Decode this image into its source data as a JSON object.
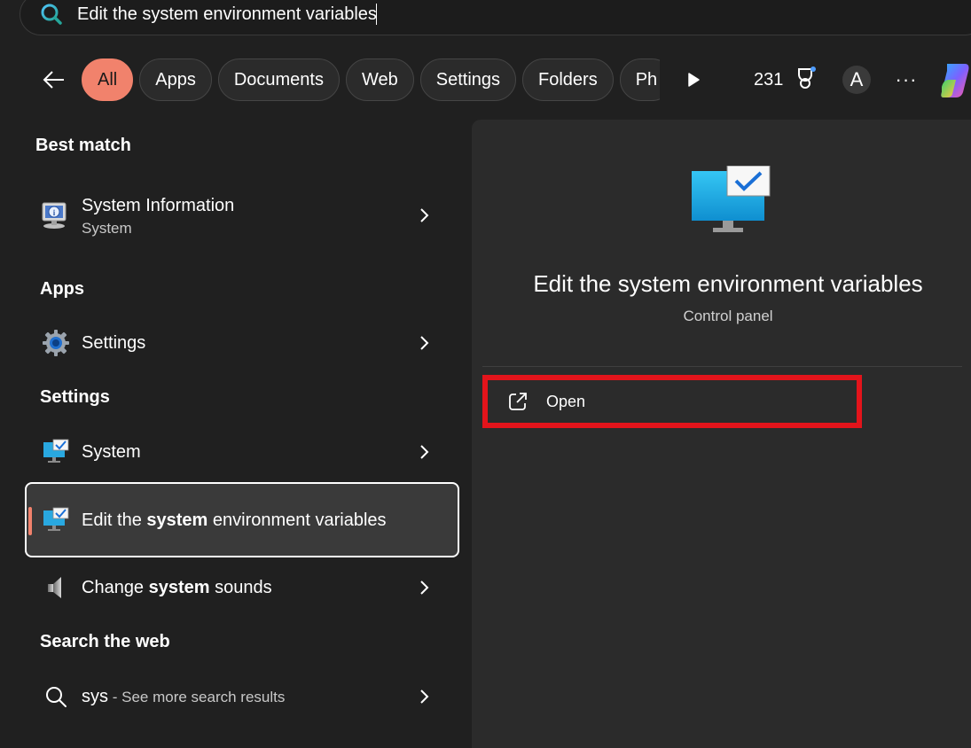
{
  "search": {
    "query": "Edit the system environment variables"
  },
  "filters": {
    "chips": [
      "All",
      "Apps",
      "Documents",
      "Web",
      "Settings",
      "Folders",
      "Ph"
    ],
    "active": "All",
    "points": "231",
    "avatar_letter": "A",
    "more": "···"
  },
  "results": {
    "best_match_title": "Best match",
    "best_match": {
      "title": "System Information",
      "subtitle": "System",
      "icon": "system-information-icon"
    },
    "apps_title": "Apps",
    "apps": [
      {
        "title": "Settings",
        "icon": "settings-gear-icon"
      }
    ],
    "settings_title": "Settings",
    "settings": [
      {
        "title": "System",
        "icon": "monitor-check-icon"
      },
      {
        "title_pre": "Edit the ",
        "title_bold": "system",
        "title_post": " environment variables",
        "icon": "monitor-check-icon"
      },
      {
        "title_pre": "Change ",
        "title_bold": "system",
        "title_post": " sounds",
        "icon": "speaker-icon"
      }
    ],
    "web_title": "Search the web",
    "web": {
      "query": "sys",
      "suffix": " - See more search results",
      "icon": "search-icon"
    }
  },
  "detail": {
    "title": "Edit the system environment variables",
    "subtitle": "Control panel",
    "action_label": "Open",
    "highlight_color": "#e3141b"
  },
  "colors": {
    "accent": "#f1826c",
    "background": "#202020",
    "pane": "#2b2b2b"
  }
}
